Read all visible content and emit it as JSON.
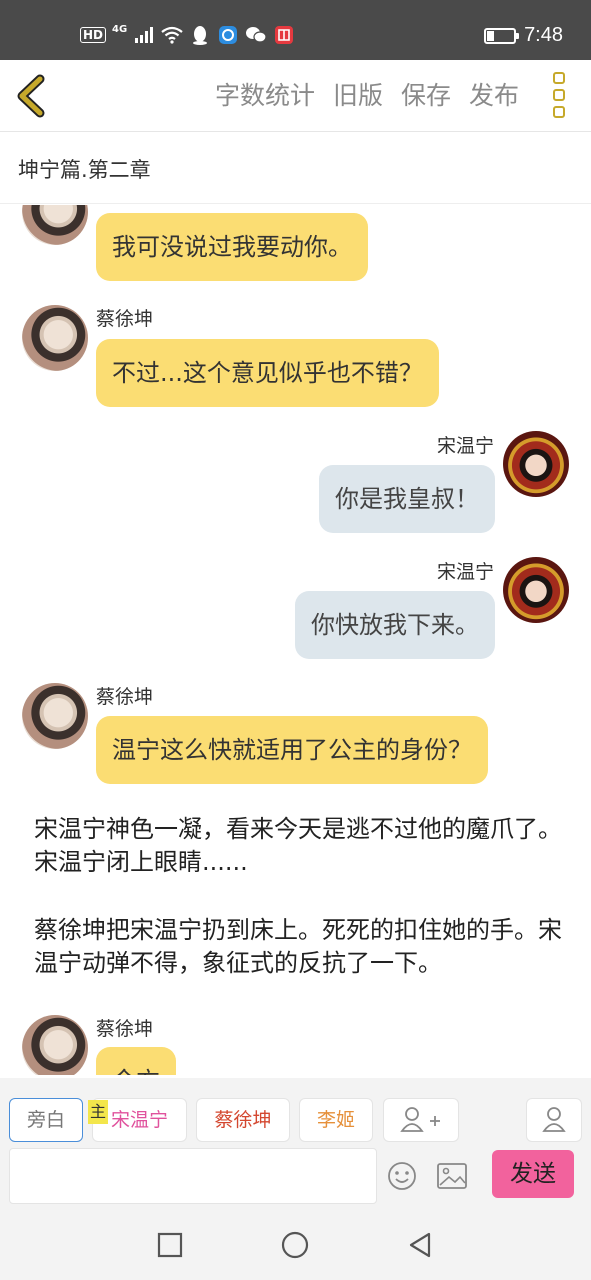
{
  "status_bar": {
    "network": "HD",
    "signal_label": "4G",
    "time": "7:48"
  },
  "toolbar": {
    "word_count_label": "字数统计",
    "old_version_label": "旧版",
    "save_label": "保存",
    "publish_label": "发布",
    "accent_color": "#c6a92b"
  },
  "chapter": {
    "title": "坤宁篇.第二章"
  },
  "messages": [
    {
      "speaker": "",
      "text": "我可没说过我要动你。"
    },
    {
      "speaker": "蔡徐坤",
      "text": "不过...这个意见似乎也不错？"
    },
    {
      "speaker": "宋温宁",
      "text": "你是我皇叔！"
    },
    {
      "speaker": "宋温宁",
      "text": "你快放我下来。"
    },
    {
      "speaker": "蔡徐坤",
      "text": "温宁这么快就适用了公主的身份？"
    },
    {
      "speaker": "",
      "text": "宋温宁神色一凝，看来今天是逃不过他的魔爪了。宋温宁闭上眼睛......"
    },
    {
      "speaker": "",
      "text": "蔡徐坤把宋温宁扔到床上。死死的扣住她的手。宋温宁动弹不得，象征式的反抗了一下。"
    },
    {
      "speaker": "蔡徐坤",
      "text": "今方"
    }
  ],
  "roles": {
    "narrator": "旁白",
    "song": "宋温宁",
    "cai": "蔡徐坤",
    "li": "李姬",
    "main_badge": "主"
  },
  "composer": {
    "send_label": "发送",
    "send_color": "#f2629d"
  },
  "icons": {
    "back": "chevron-left-icon",
    "more": "more-icon",
    "add_role": "add-person-icon",
    "user": "person-icon",
    "emoji": "emoji-icon",
    "image": "image-icon"
  }
}
